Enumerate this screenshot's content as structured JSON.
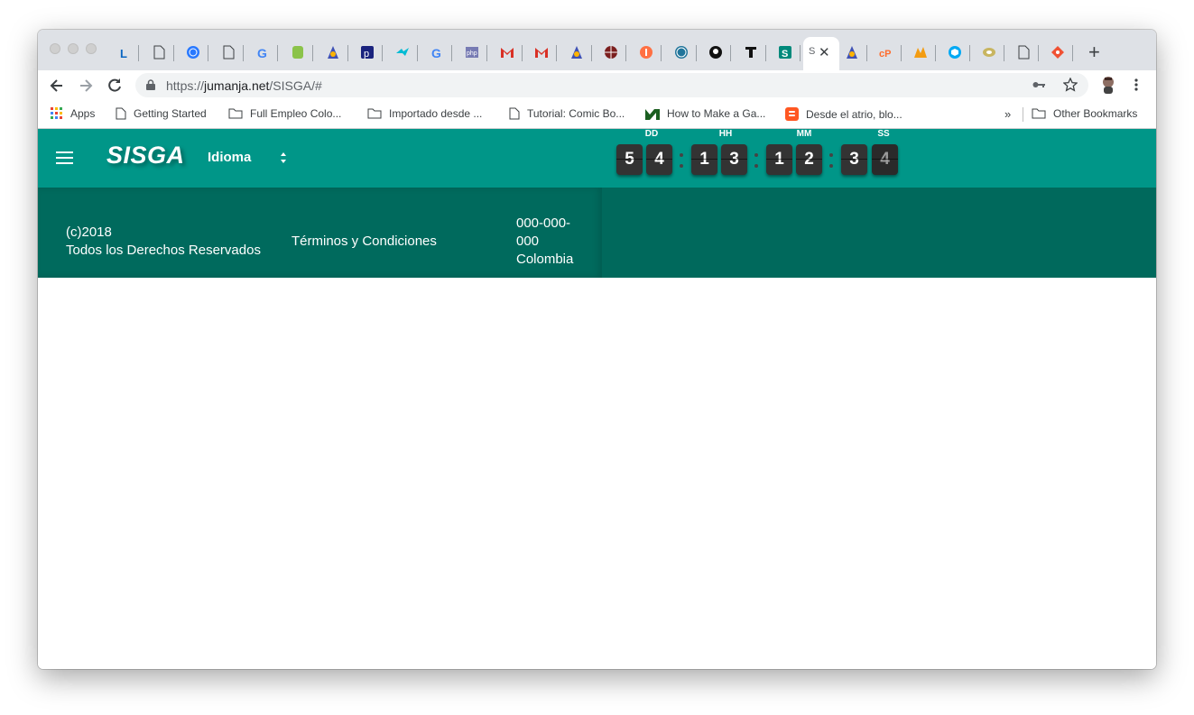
{
  "browser": {
    "tabs": [
      {
        "icon": "linkedin-l-icon"
      },
      {
        "icon": "page-icon"
      },
      {
        "icon": "globe-blue-icon"
      },
      {
        "icon": "page-icon"
      },
      {
        "icon": "google-icon"
      },
      {
        "icon": "green-shield-icon"
      },
      {
        "icon": "wizard-icon"
      },
      {
        "icon": "pp-icon"
      },
      {
        "icon": "teal-bird-icon"
      },
      {
        "icon": "google-icon"
      },
      {
        "icon": "php-icon"
      },
      {
        "icon": "gmail-icon"
      },
      {
        "icon": "gmail-icon"
      },
      {
        "icon": "wizard-icon"
      },
      {
        "icon": "globe-dark-icon"
      },
      {
        "icon": "orange-circle-icon"
      },
      {
        "icon": "wordpress-icon"
      },
      {
        "icon": "github-icon"
      },
      {
        "icon": "t-icon"
      },
      {
        "icon": "green-s-icon"
      }
    ],
    "tabs_after_active": [
      {
        "icon": "wizard-icon"
      },
      {
        "icon": "cpanel-icon"
      },
      {
        "icon": "phpmyadmin-icon"
      },
      {
        "icon": "blue-cube-icon"
      },
      {
        "icon": "disc-icon"
      },
      {
        "icon": "page-icon"
      },
      {
        "icon": "git-icon"
      }
    ],
    "active_tab": {
      "favicon_text": "S",
      "close": "✕"
    },
    "new_tab": "+",
    "url_scheme": "https://",
    "url_host": "jumanja.net",
    "url_path": "/SISGA/#",
    "bookmarks": [
      {
        "label": "Apps",
        "icon": "apps-grid-icon"
      },
      {
        "label": "Getting Started",
        "icon": "page-icon"
      },
      {
        "label": "Full Empleo Colo...",
        "icon": "folder-icon"
      },
      {
        "label": "Importado desde ...",
        "icon": "folder-icon"
      },
      {
        "label": "Tutorial: Comic Bo...",
        "icon": "page-icon"
      },
      {
        "label": "How to Make a Ga...",
        "icon": "m-logo-icon"
      },
      {
        "label": "Desde el atrio, blo...",
        "icon": "blogger-icon"
      }
    ],
    "more_bookmarks": "»",
    "other_bookmarks": "Other Bookmarks"
  },
  "app": {
    "brand": "SISGA",
    "language_label": "Idioma",
    "countdown": {
      "labels": [
        "DD",
        "HH",
        "MM",
        "SS"
      ],
      "digits": [
        [
          "5",
          "4"
        ],
        [
          "1",
          "3"
        ],
        [
          "1",
          "2"
        ],
        [
          "3",
          "4"
        ]
      ]
    },
    "footer": {
      "copyright_line1": "(c)2018",
      "copyright_line2": "Todos los Derechos Reservados",
      "terms_link": "Términos y Condiciones",
      "phone_line1": "000-000-",
      "phone_line2": "000",
      "country": "Colombia"
    }
  },
  "colors": {
    "primary": "#009688",
    "footer": "#00695c",
    "digit_bg": "#333333"
  }
}
